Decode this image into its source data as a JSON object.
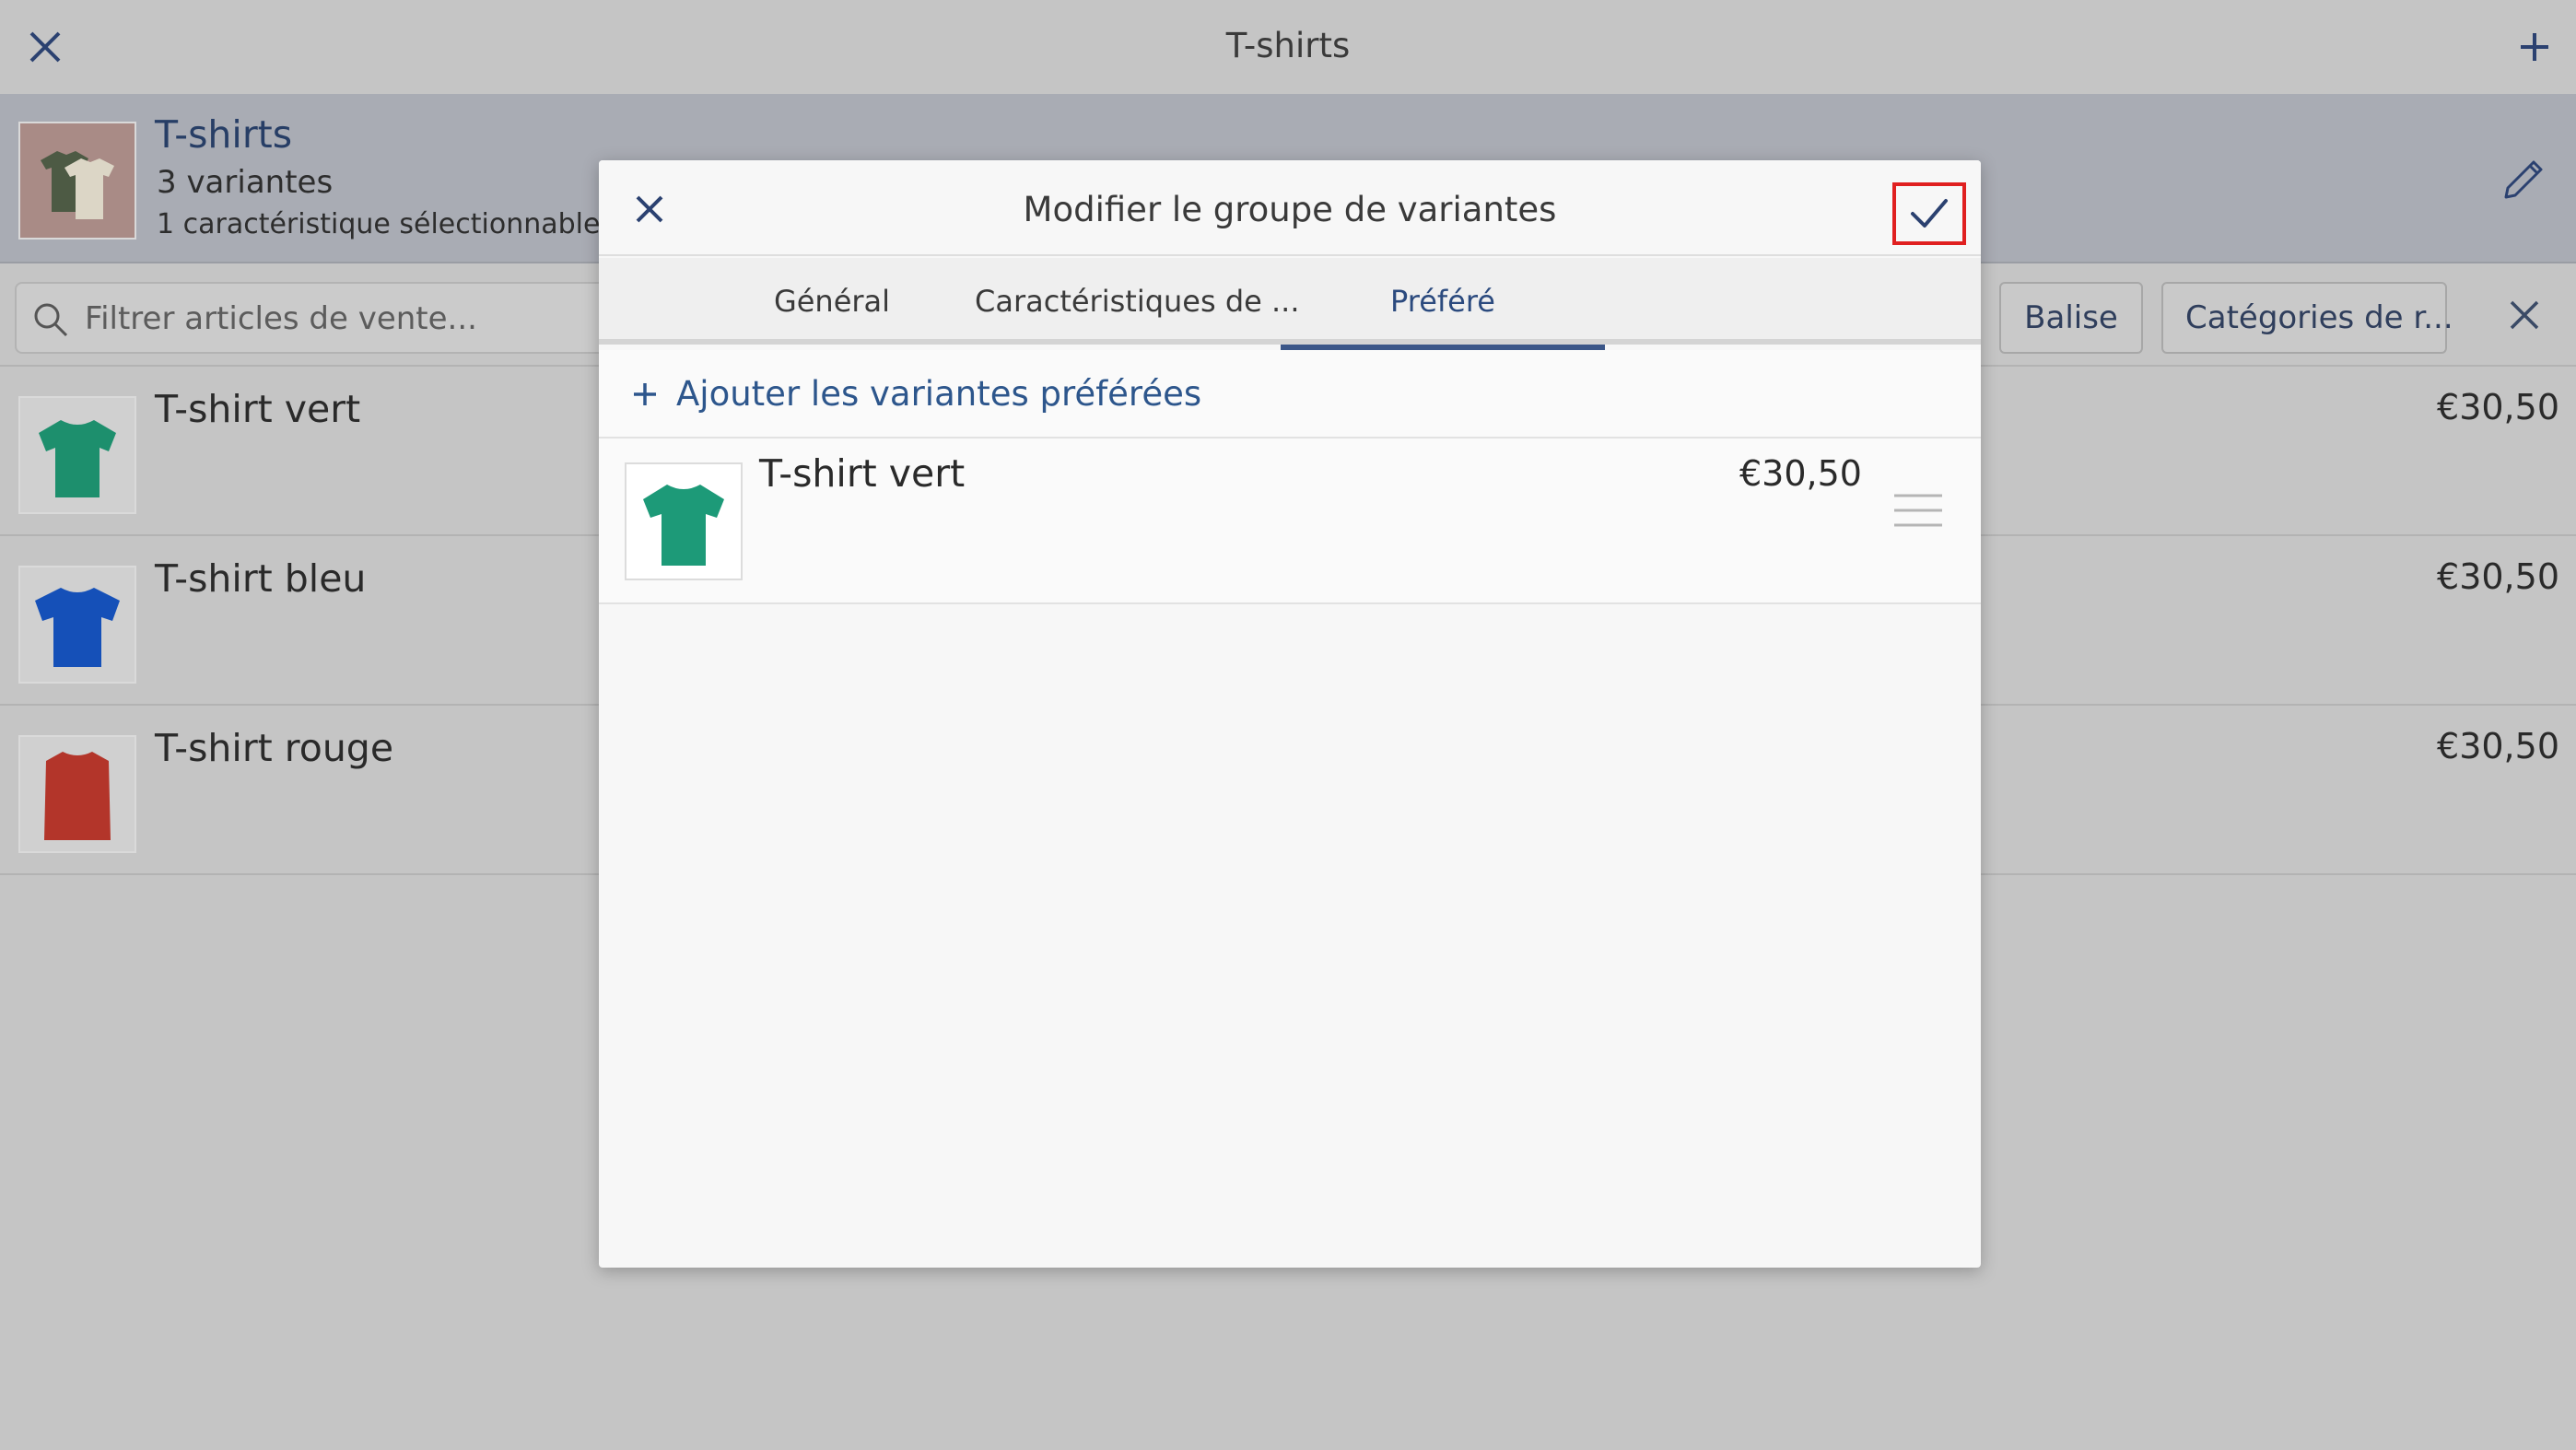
{
  "topbar": {
    "title": "T-shirts"
  },
  "group": {
    "title": "T-shirts",
    "variants": "3 variantes",
    "characteristics": "1 caractéristique sélectionnable"
  },
  "filter": {
    "placeholder": "Filtrer articles de vente...",
    "chips": [
      "Balise",
      "Catégories de r..."
    ]
  },
  "items": [
    {
      "name": "T-shirt vert",
      "price": "€30,50",
      "color": "#1d8f6d"
    },
    {
      "name": "T-shirt bleu",
      "price": "€30,50",
      "color": "#1550b8"
    },
    {
      "name": "T-shirt rouge",
      "price": "€30,50",
      "color": "#b3352a"
    }
  ],
  "modal": {
    "title": "Modifier le groupe de variantes",
    "tabs": [
      "Général",
      "Caractéristiques de ...",
      "Préféré"
    ],
    "active_tab": "Préféré",
    "add_label": "Ajouter les variantes préférées",
    "preferred": [
      {
        "name": "T-shirt vert",
        "price": "€30,50",
        "color": "#1d9a78"
      }
    ]
  },
  "colors": {
    "accent": "#2d568c",
    "highlight": "#e02020"
  }
}
